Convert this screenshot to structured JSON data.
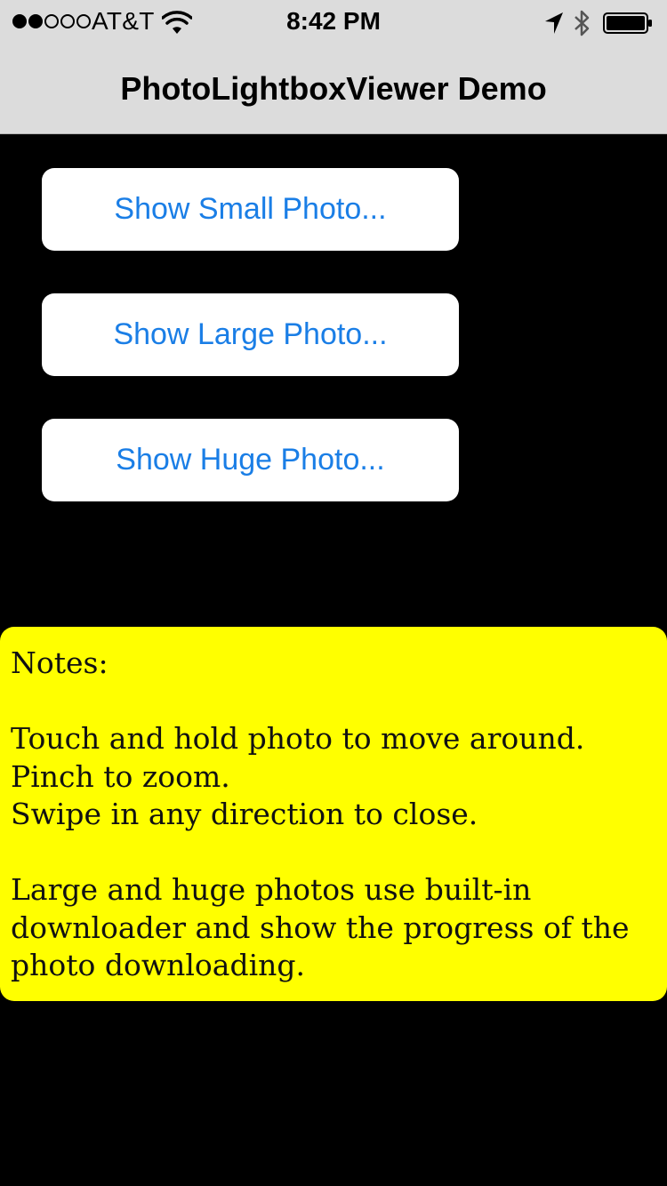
{
  "status_bar": {
    "signal_bars_filled": 2,
    "signal_bars_total": 5,
    "carrier": "AT&T",
    "time": "8:42 PM",
    "icons": [
      "wifi-icon",
      "location-arrow-icon",
      "bluetooth-icon",
      "battery-icon"
    ],
    "battery_level": 1.0
  },
  "nav": {
    "title": "PhotoLightboxViewer Demo"
  },
  "buttons": {
    "small": "Show Small Photo...",
    "large": "Show Large Photo...",
    "huge": "Show Huge Photo..."
  },
  "notes": {
    "heading": "Notes:",
    "lines_group1": [
      "Touch and hold photo to move around.",
      "Pinch to zoom.",
      "Swipe in any direction to close."
    ],
    "lines_group2": [
      "Large and huge photos use built-in",
      "downloader and show the progress of the",
      "photo downloading."
    ]
  },
  "colors": {
    "background": "#000000",
    "nav_background": "#dcdcdc",
    "button_text": "#1a7ee6",
    "notes_background": "#ffff00"
  }
}
